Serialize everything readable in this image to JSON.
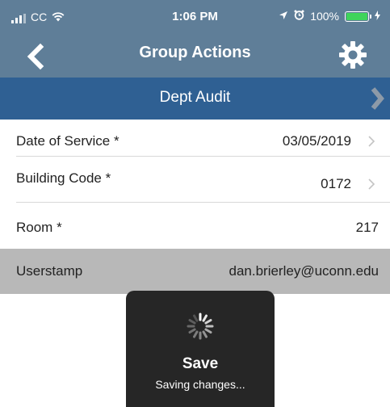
{
  "status_bar": {
    "carrier": "CC",
    "time": "1:06 PM",
    "battery_percent": "100%",
    "battery_color": "#3fd45b"
  },
  "nav": {
    "title": "Group Actions",
    "back_icon": "chevron-left-icon",
    "settings_icon": "gear-icon"
  },
  "section": {
    "title": "Dept Audit"
  },
  "fields": [
    {
      "label": "Date of Service *",
      "value": "03/05/2019"
    },
    {
      "label": "Building Code *",
      "value": "0172"
    },
    {
      "label": "Room *",
      "value": "217"
    },
    {
      "label": "Userstamp",
      "value": "dan.brierley@uconn.edu"
    }
  ],
  "toast": {
    "title": "Save",
    "message": "Saving changes..."
  },
  "colors": {
    "nav_bg": "#5f7e98",
    "section_bg": "#2f6093",
    "readonly_row_bg": "#b8b8b8",
    "toast_bg": "#262626"
  }
}
